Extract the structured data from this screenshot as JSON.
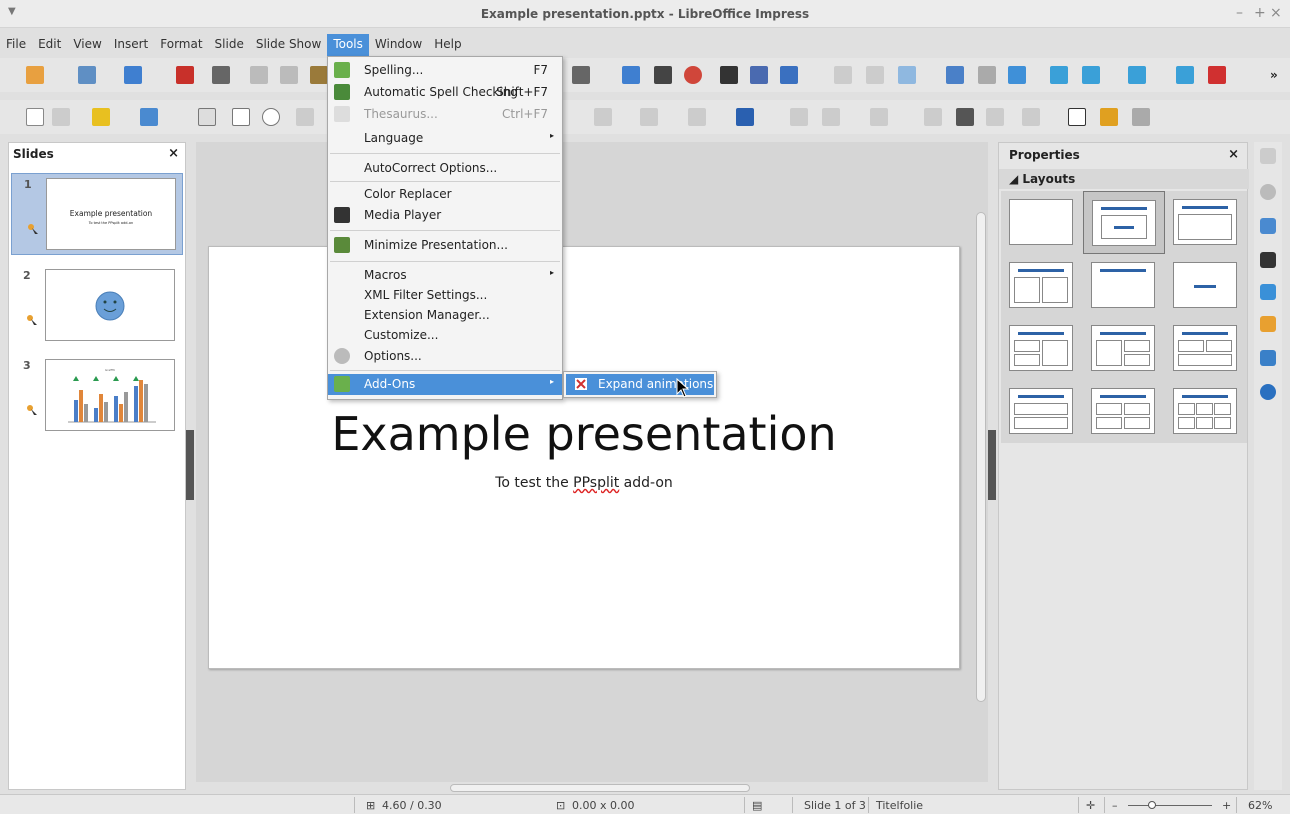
{
  "window": {
    "title": "Example presentation.pptx - LibreOffice Impress",
    "controls": [
      "–",
      "+",
      "×"
    ]
  },
  "menubar": [
    {
      "label": "File"
    },
    {
      "label": "Edit"
    },
    {
      "label": "View"
    },
    {
      "label": "Insert"
    },
    {
      "label": "Format"
    },
    {
      "label": "Slide"
    },
    {
      "label": "Slide Show"
    },
    {
      "label": "Tools"
    },
    {
      "label": "Window"
    },
    {
      "label": "Help"
    }
  ],
  "tools_menu": {
    "items": [
      {
        "label": "Spelling...",
        "shortcut": "F7",
        "icon": "spelling-icon"
      },
      {
        "label": "Automatic Spell Checking",
        "shortcut": "Shift+F7",
        "icon": "auto-spellcheck-icon"
      },
      {
        "label": "Thesaurus...",
        "shortcut": "Ctrl+F7",
        "icon": "thesaurus-icon"
      },
      {
        "label": "Language"
      },
      {
        "label": "AutoCorrect Options..."
      },
      {
        "label": "Color Replacer"
      },
      {
        "label": "Media Player",
        "icon": "media-player-icon"
      },
      {
        "label": "Minimize Presentation...",
        "icon": "minimize-presentation-icon"
      },
      {
        "label": "Macros"
      },
      {
        "label": "XML Filter Settings..."
      },
      {
        "label": "Extension Manager..."
      },
      {
        "label": "Customize..."
      },
      {
        "label": "Options...",
        "icon": "options-gear-icon"
      },
      {
        "label": "Add-Ons",
        "icon": "addons-puzzle-icon"
      }
    ],
    "submenu": {
      "label": "Expand animations"
    }
  },
  "slides_pane": {
    "title": "Slides",
    "close": "×",
    "slides": [
      {
        "number": "1",
        "title": "Example presentation",
        "subtitle": "To test the PPsplit add-on"
      },
      {
        "number": "2"
      },
      {
        "number": "3",
        "chart_title": "Graffiti"
      }
    ]
  },
  "slide": {
    "title": "Example presentation",
    "subtitle_pre": "To test the ",
    "subtitle_misspelled": "PPsplit",
    "subtitle_post": " add-on"
  },
  "properties": {
    "title": "Properties",
    "close": "×",
    "section": "◢ Layouts"
  },
  "statusbar": {
    "position": "4.60 / 0.30",
    "size": "0.00 x 0.00",
    "slide": "Slide 1 of 3",
    "layout_name": "Titelfolie",
    "zoom": "62%",
    "zoom_minus": "–",
    "zoom_plus": "+"
  },
  "colors": {
    "accent": "#4a90d9",
    "layout_bar": "#2d62a6"
  }
}
